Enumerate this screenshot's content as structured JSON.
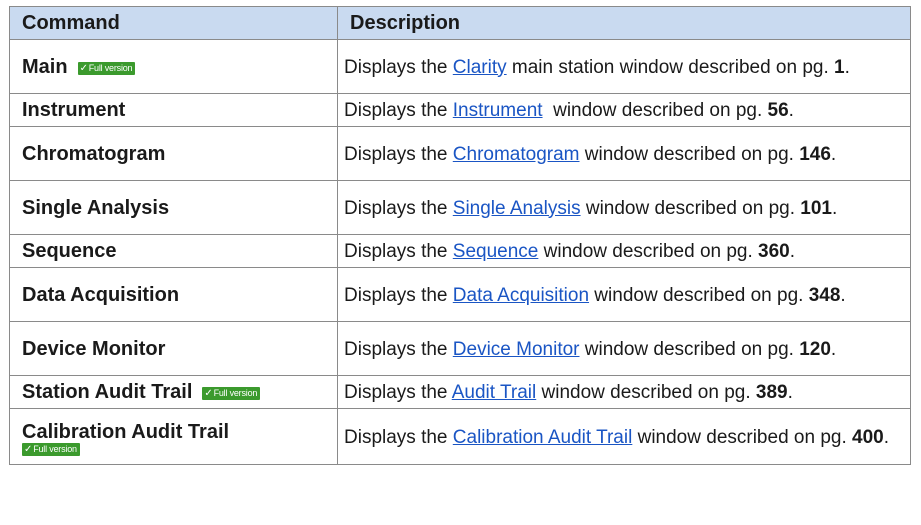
{
  "table": {
    "headers": [
      "Command",
      "Description"
    ],
    "rows": [
      {
        "command": "Main",
        "badge": "Full version",
        "desc_pre": "Displays the ",
        "link": "Clarity",
        "desc_mid": " main station window described on pg. ",
        "page": "1",
        "desc_post": "."
      },
      {
        "command": "Instrument",
        "badge": "",
        "desc_pre": "Displays the ",
        "link": "Instrument",
        "desc_mid": "  window described on pg. ",
        "page": "56",
        "desc_post": "."
      },
      {
        "command": "Chromatogram",
        "badge": "",
        "desc_pre": "Displays the ",
        "link": "Chromatogram",
        "desc_mid": " window described on pg. ",
        "page": "146",
        "desc_post": "."
      },
      {
        "command": "Single Analysis",
        "badge": "",
        "desc_pre": "Displays the ",
        "link": "Single Analysis",
        "desc_mid": " window described on pg. ",
        "page": "101",
        "desc_post": "."
      },
      {
        "command": "Sequence",
        "badge": "",
        "desc_pre": "Displays the ",
        "link": "Sequence",
        "desc_mid": " window described on pg. ",
        "page": "360",
        "desc_post": "."
      },
      {
        "command": "Data Acquisition",
        "badge": "",
        "desc_pre": "Displays the ",
        "link": "Data Acquisition",
        "desc_mid": " window described on pg. ",
        "page": "348",
        "desc_post": "."
      },
      {
        "command": "Device Monitor",
        "badge": "",
        "desc_pre": "Displays the ",
        "link": "Device Monitor",
        "desc_mid": " window described on pg. ",
        "page": "120",
        "desc_post": "."
      },
      {
        "command": "Station Audit Trail",
        "badge": "Full version",
        "desc_pre": "Displays the ",
        "link": "Audit Trail",
        "desc_mid": " window described on pg. ",
        "page": "389",
        "desc_post": "."
      },
      {
        "command": "Calibration Audit Trail",
        "badge": "Full version",
        "desc_pre": "Displays the ",
        "link": "Calibration Audit Trail",
        "desc_mid": " window described on pg. ",
        "page": "400",
        "desc_post": "."
      }
    ]
  },
  "colors": {
    "header_bg": "#c9daf0",
    "link": "#1a55c4",
    "badge_bg": "#3b9a2d",
    "border": "#8a8a8a"
  },
  "icons": {
    "badge_check": "check-icon"
  }
}
